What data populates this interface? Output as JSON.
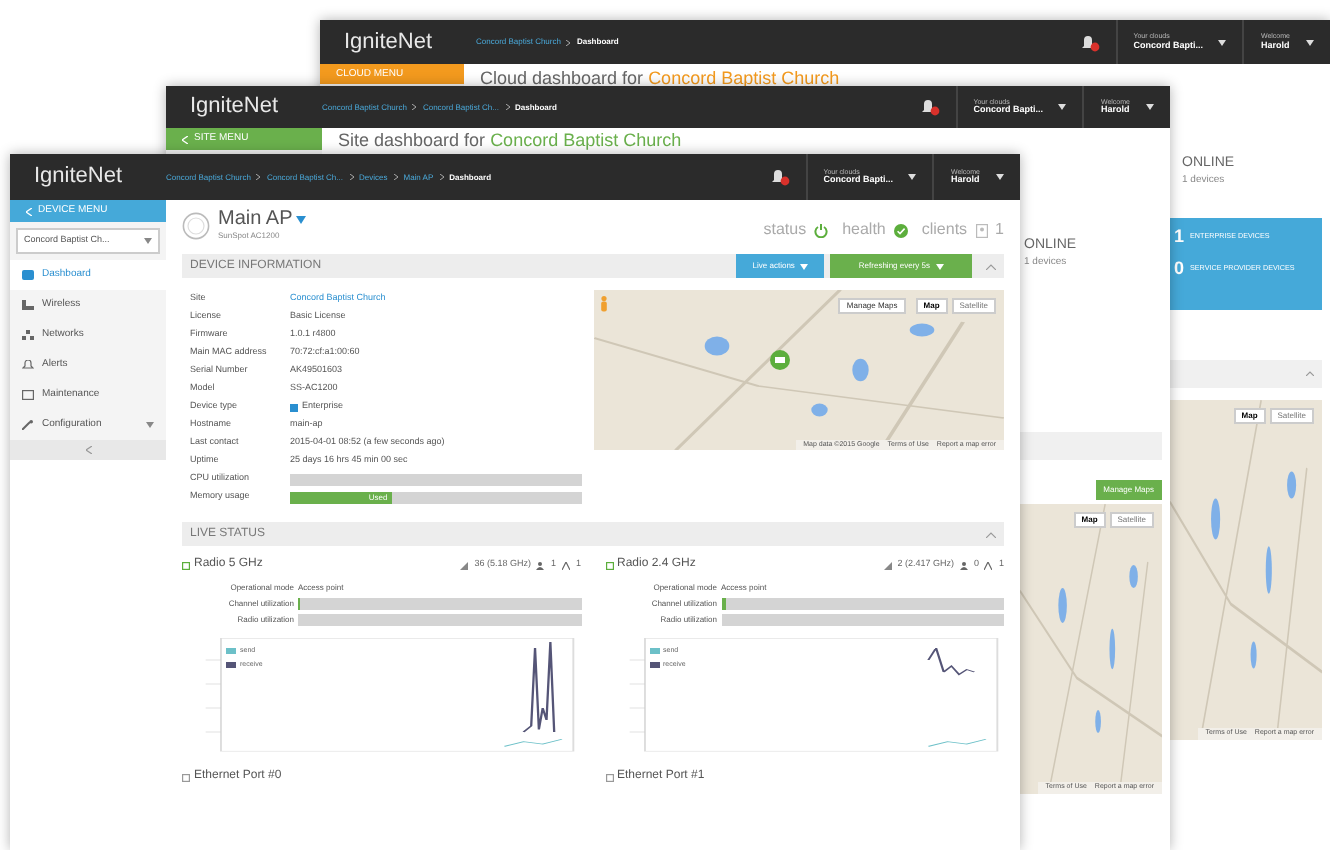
{
  "cloud_window": {
    "header": {
      "logo": "IgniteNet",
      "breadcrumb": [
        "Concord Baptist Church",
        "Dashboard"
      ],
      "clouds_label": "Your clouds",
      "clouds_value": "Concord Bapti...",
      "welcome": "Welcome",
      "user": "Harold"
    },
    "menu_title": "CLOUD MENU",
    "title": "Cloud dashboard for ",
    "title_link": "Concord Baptist Church",
    "online": {
      "label": "ONLINE",
      "count": "1 devices"
    },
    "device_counts": [
      {
        "count": "1",
        "label": "ENTERPRISE DEVICES"
      },
      {
        "count": "0",
        "label": "SERVICE PROVIDER DEVICES"
      }
    ],
    "map_types": [
      {
        "label": "Map",
        "selected": true
      },
      {
        "label": "Satellite",
        "selected": false
      }
    ],
    "map_footer": [
      "Terms of Use",
      "Report a map error"
    ]
  },
  "site_window": {
    "header": {
      "logo": "IgniteNet",
      "breadcrumb": [
        "Concord Baptist Church",
        "Concord Baptist Ch...",
        "Dashboard"
      ],
      "clouds_label": "Your clouds",
      "clouds_value": "Concord Bapti...",
      "welcome": "Welcome",
      "user": "Harold"
    },
    "menu_title": "SITE MENU",
    "title": "Site dashboard for ",
    "title_link": "Concord Baptist Church",
    "online": {
      "label": "ONLINE",
      "count": "1 devices"
    },
    "manage_maps": "Manage Maps",
    "map_types": [
      {
        "label": "Map",
        "selected": true
      },
      {
        "label": "Satellite",
        "selected": false
      }
    ],
    "map_footer": [
      "Terms of Use",
      "Report a map error"
    ]
  },
  "device_window": {
    "header": {
      "logo": "IgniteNet",
      "breadcrumb": [
        "Concord Baptist Church",
        "Concord Baptist Ch...",
        "Devices",
        "Main AP",
        "Dashboard"
      ],
      "clouds_label": "Your clouds",
      "clouds_value": "Concord Bapti...",
      "welcome": "Welcome",
      "user": "Harold"
    },
    "menu_title": "DEVICE MENU",
    "site_select": "Concord Baptist Ch...",
    "menu_items": [
      {
        "label": "Dashboard",
        "selected": true
      },
      {
        "label": "Wireless",
        "selected": false
      },
      {
        "label": "Networks",
        "selected": false
      },
      {
        "label": "Alerts",
        "selected": false
      },
      {
        "label": "Maintenance",
        "selected": false
      },
      {
        "label": "Configuration",
        "selected": false,
        "submenu": true
      }
    ],
    "device_name": "Main AP",
    "device_model": "SunSpot AC1200",
    "status_label": "status",
    "health_label": "health",
    "clients_label": "clients",
    "clients_count": "1",
    "info_title": "DEVICE INFORMATION",
    "live_actions": "Live actions",
    "refresh": "Refreshing every 5s",
    "info_rows": [
      {
        "label": "Site",
        "value": "Concord Baptist Church",
        "kind": "link"
      },
      {
        "label": "License",
        "value": "Basic License",
        "kind": "text"
      },
      {
        "label": "Firmware",
        "value": "1.0.1 r4800",
        "kind": "text"
      },
      {
        "label": "Main MAC address",
        "value": "70:72:cf:a1:00:60",
        "kind": "text"
      },
      {
        "label": "Serial Number",
        "value": "AK49501603",
        "kind": "text"
      },
      {
        "label": "Model",
        "value": "SS-AC1200",
        "kind": "text"
      },
      {
        "label": "Device type",
        "value": "Enterprise",
        "kind": "checkbox",
        "checked": true
      },
      {
        "label": "Hostname",
        "value": "main-ap",
        "kind": "text"
      },
      {
        "label": "Last contact",
        "value": "2015-04-01 08:52 (a few seconds ago)",
        "kind": "text"
      },
      {
        "label": "Uptime",
        "value": "25 days 16 hrs 45 min 00 sec",
        "kind": "text"
      },
      {
        "label": "CPU utilization",
        "kind": "bar",
        "level": 0.0
      },
      {
        "label": "Memory usage",
        "kind": "bar",
        "level": 0.35,
        "bar_text": "Used"
      }
    ],
    "map_buttons": {
      "manage": "Manage Maps",
      "types": [
        {
          "label": "Map",
          "selected": true
        },
        {
          "label": "Satellite",
          "selected": false
        }
      ]
    },
    "map_footer": [
      "Map data ©2015 Google",
      "Terms of Use",
      "Report a map error"
    ],
    "live_title": "LIVE STATUS",
    "radios": [
      {
        "name": "Radio 5 GHz",
        "channel": "36 (5.18 GHz)",
        "users": "1",
        "clients": "1",
        "mode_label": "Operational mode",
        "mode": "Access point",
        "channel_util_label": "Channel utilization",
        "channel_util": {
          "level": 0.01
        },
        "radio_util_label": "Radio utilization",
        "radio_util": {
          "level": 0.0
        },
        "legend": [
          "send",
          "receive"
        ]
      },
      {
        "name": "Radio 2.4 GHz",
        "channel": "2 (2.417 GHz)",
        "users": "0",
        "clients": "1",
        "mode_label": "Operational mode",
        "mode": "Access point",
        "channel_util_label": "Channel utilization",
        "channel_util": {
          "level": 0.02
        },
        "radio_util_label": "Radio utilization",
        "radio_util": {
          "level": 0.0
        },
        "legend": [
          "send",
          "receive"
        ]
      }
    ],
    "ports": [
      "Ethernet Port #0",
      "Ethernet Port #1"
    ]
  }
}
